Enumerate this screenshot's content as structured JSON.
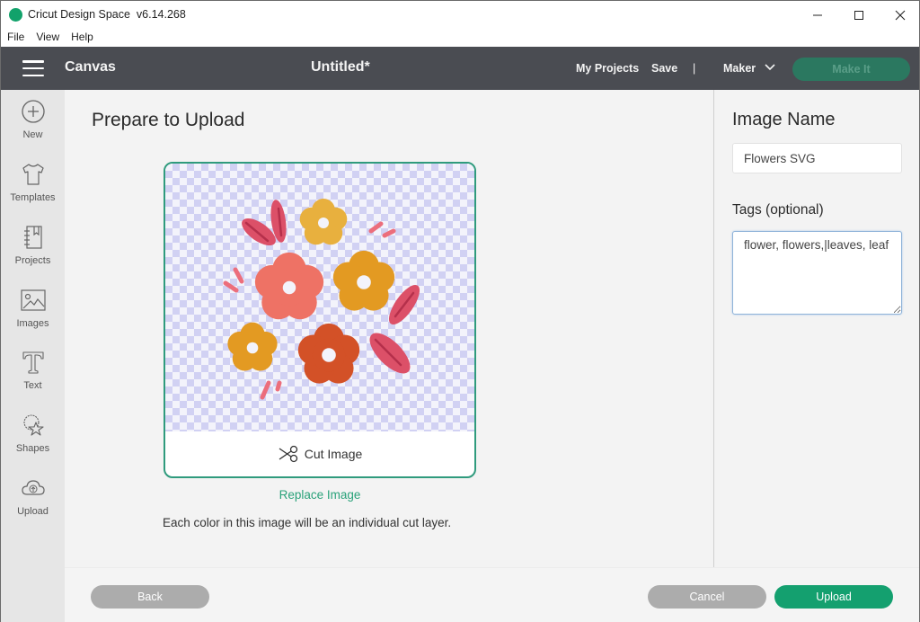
{
  "window": {
    "title": "Cricut Design Space",
    "version": "v6.14.268",
    "controls": {
      "minimize": "—",
      "maximize": "☐",
      "close": "✕"
    },
    "logo_color": "#12a26b"
  },
  "menubar": {
    "items": [
      "File",
      "View",
      "Help"
    ]
  },
  "appbar": {
    "section": "Canvas",
    "project_title": "Untitled*",
    "my_projects": "My Projects",
    "save": "Save",
    "separator": "|",
    "machine": "Maker",
    "make_it": "Make It",
    "background": "#4a4c52"
  },
  "sidebar": {
    "items": [
      {
        "label": "New",
        "icon": "plus-circle-icon"
      },
      {
        "label": "Templates",
        "icon": "tshirt-icon"
      },
      {
        "label": "Projects",
        "icon": "notebook-icon"
      },
      {
        "label": "Images",
        "icon": "image-icon"
      },
      {
        "label": "Text",
        "icon": "text-t-icon"
      },
      {
        "label": "Shapes",
        "icon": "shapes-icon"
      },
      {
        "label": "Upload",
        "icon": "cloud-upload-icon"
      }
    ]
  },
  "main": {
    "title": "Prepare to Upload",
    "cut_image_label": "Cut Image",
    "replace_image": "Replace Image",
    "info": "Each color in this image will be an individual cut layer.",
    "accent_color": "#2aa27a"
  },
  "right_panel": {
    "image_name_heading": "Image Name",
    "image_name_value": "Flowers SVG",
    "tags_label": "Tags (optional)",
    "tags_value": "flower, flowers,|leaves, leaf"
  },
  "footer": {
    "back": "Back",
    "cancel": "Cancel",
    "upload": "Upload",
    "upload_color": "#14a06f"
  }
}
